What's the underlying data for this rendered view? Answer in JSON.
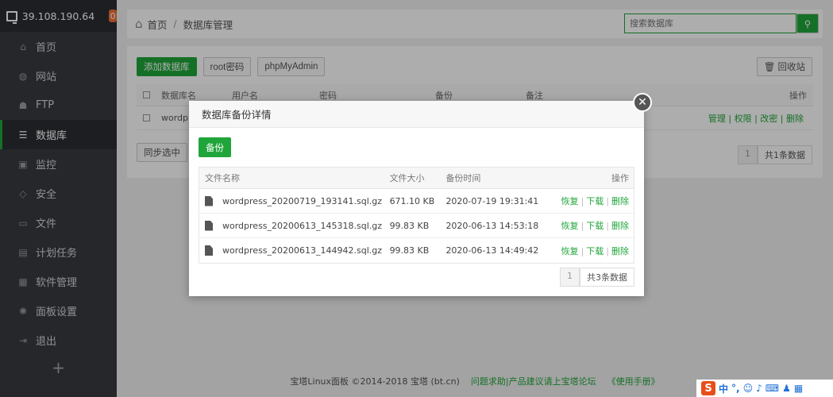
{
  "sidebar": {
    "ip": "39.108.190.64",
    "badge": "0",
    "items": [
      {
        "label": "首页",
        "icon": "home-icon"
      },
      {
        "label": "网站",
        "icon": "globe-icon"
      },
      {
        "label": "FTP",
        "icon": "ftp-icon"
      },
      {
        "label": "数据库",
        "icon": "database-icon"
      },
      {
        "label": "监控",
        "icon": "monitor-icon"
      },
      {
        "label": "安全",
        "icon": "shield-icon"
      },
      {
        "label": "文件",
        "icon": "folder-icon"
      },
      {
        "label": "计划任务",
        "icon": "calendar-icon"
      },
      {
        "label": "软件管理",
        "icon": "grid-icon"
      },
      {
        "label": "面板设置",
        "icon": "gear-icon"
      },
      {
        "label": "退出",
        "icon": "logout-icon"
      }
    ],
    "plus": "+"
  },
  "breadcrumb": {
    "home": "首页",
    "sep": "/",
    "current": "数据库管理"
  },
  "search": {
    "placeholder": "搜索数据库"
  },
  "toolbar": {
    "add": "添加数据库",
    "root": "root密码",
    "pma": "phpMyAdmin",
    "recycle": "回收站"
  },
  "grid": {
    "headers": [
      "数据库名",
      "用户名",
      "密码",
      "备份",
      "备注",
      "操作"
    ],
    "row": {
      "name": "wordpr",
      "ops": "管理 | 权限 | 改密 | 删除"
    }
  },
  "sync": "同步选中",
  "pager_main": {
    "page": "1",
    "total": "共1条数据"
  },
  "modal": {
    "title": "数据库备份详情",
    "backup": "备份",
    "headers": {
      "name": "文件名称",
      "size": "文件大小",
      "time": "备份时间",
      "ops": "操作"
    },
    "rows": [
      {
        "name": "wordpress_20200719_193141.sql.gz",
        "size": "671.10 KB",
        "time": "2020-07-19 19:31:41"
      },
      {
        "name": "wordpress_20200613_145318.sql.gz",
        "size": "99.83 KB",
        "time": "2020-06-13 14:53:18"
      },
      {
        "name": "wordpress_20200613_144942.sql.gz",
        "size": "99.83 KB",
        "time": "2020-06-13 14:49:42"
      }
    ],
    "ops": {
      "restore": "恢复",
      "download": "下载",
      "delete": "删除"
    },
    "pager": {
      "page": "1",
      "total": "共3条数据"
    }
  },
  "footer": {
    "copy": "宝塔Linux面板 ©2014-2018 宝塔 (bt.cn)",
    "help": "问题求助|产品建议请上宝塔论坛",
    "manual": "《使用手册》"
  },
  "tray": {
    "ime": "中"
  }
}
